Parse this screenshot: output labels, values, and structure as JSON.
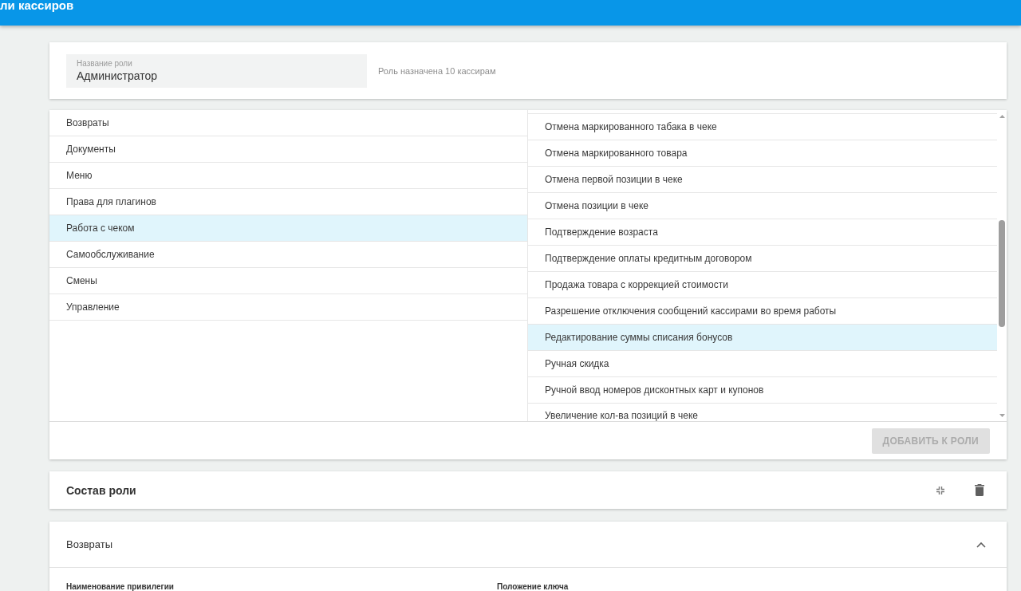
{
  "header": {
    "title": "ли кассиров"
  },
  "role_card": {
    "name_field": {
      "label": "Название роли",
      "value": "Администратор"
    },
    "assignment_note": "Роль назначена 10 кассирам"
  },
  "categories": [
    {
      "label": "Возвраты",
      "selected": false
    },
    {
      "label": "Документы",
      "selected": false
    },
    {
      "label": "Меню",
      "selected": false
    },
    {
      "label": "Права для плагинов",
      "selected": false
    },
    {
      "label": "Работа с чеком",
      "selected": true
    },
    {
      "label": "Самообслуживание",
      "selected": false
    },
    {
      "label": "Смены",
      "selected": false
    },
    {
      "label": "Управление",
      "selected": false
    }
  ],
  "privileges": [
    {
      "label": "Отмена маркированного табака в чеке",
      "selected": false
    },
    {
      "label": "Отмена маркированного товара",
      "selected": false
    },
    {
      "label": "Отмена первой позиции в чеке",
      "selected": false
    },
    {
      "label": "Отмена позиции в чеке",
      "selected": false
    },
    {
      "label": "Подтверждение возраста",
      "selected": false
    },
    {
      "label": "Подтверждение оплаты кредитным договором",
      "selected": false
    },
    {
      "label": "Продажа товара с коррекцией стоимости",
      "selected": false
    },
    {
      "label": "Разрешение отключения сообщений кассирами во время работы",
      "selected": false
    },
    {
      "label": "Редактирование суммы списания бонусов",
      "selected": true
    },
    {
      "label": "Ручная скидка",
      "selected": false
    },
    {
      "label": "Ручной ввод номеров дисконтных карт и купонов",
      "selected": false
    },
    {
      "label": "Увеличение кол-ва позиций в чеке",
      "selected": false
    }
  ],
  "add_button": {
    "label": "ДОБАВИТЬ К РОЛИ",
    "disabled": true
  },
  "composition": {
    "title": "Состав роли"
  },
  "group": {
    "title": "Возвраты",
    "expanded": true,
    "columns": [
      "Наименование привилегии",
      "Положение ключа"
    ]
  }
}
